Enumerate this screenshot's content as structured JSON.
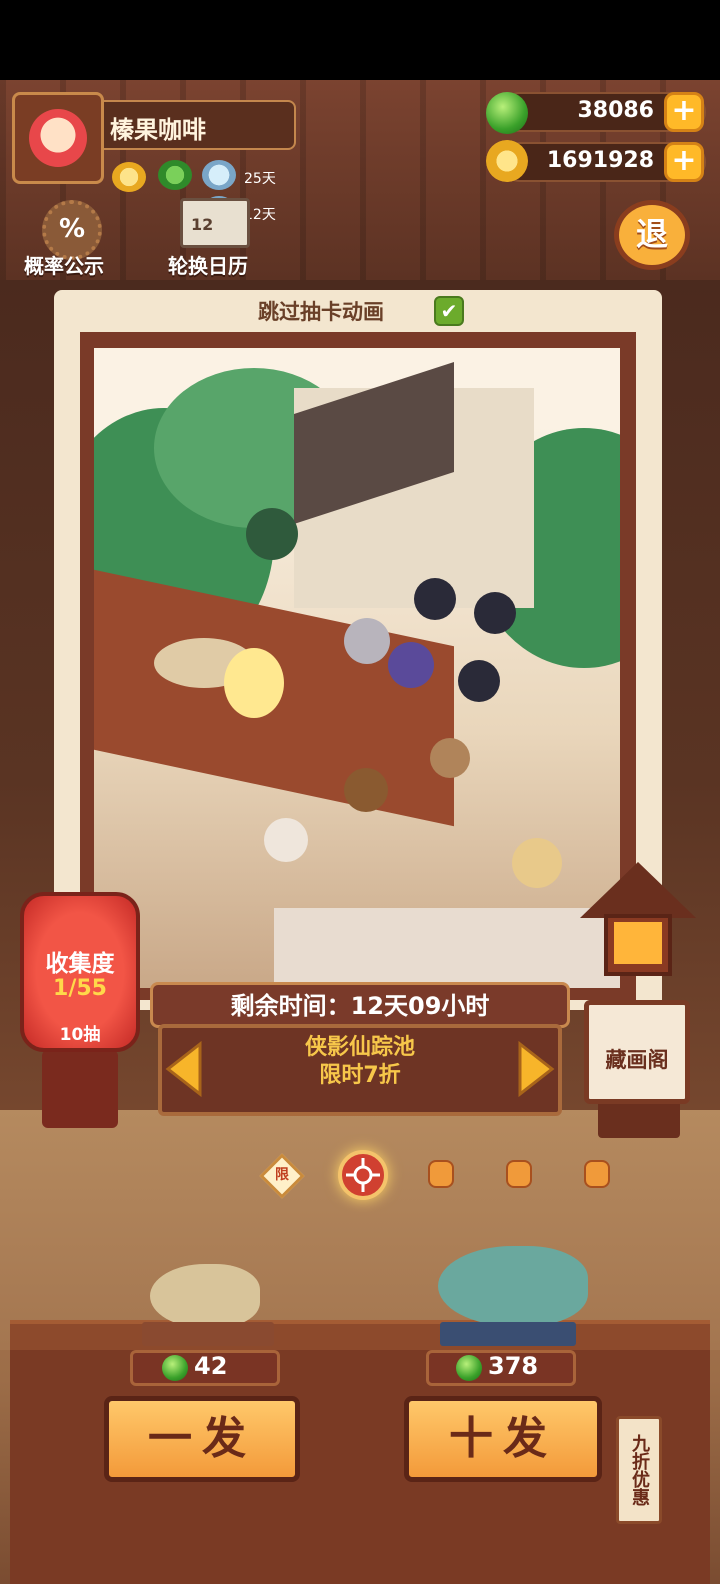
{
  "profile": {
    "name": "榛果咖啡",
    "buff_days_1": "25天",
    "buff_days_2": "12天"
  },
  "currency": {
    "gems": "38086",
    "coins": "1691928",
    "plus_label": "+"
  },
  "side_buttons": {
    "probability_icon": "%",
    "probability_label": "概率公示",
    "rotation_label": "轮换日历",
    "calendar_number": "12",
    "exit_label": "退"
  },
  "card": {
    "skip_animation_label": "跳过抽卡动画",
    "skip_checked": true,
    "check_mark": "✔"
  },
  "banner": {
    "timer": "剩余时间：12天09小时",
    "pool_name_line1": "侠影仙踪池",
    "pool_name_line2": "限时7折"
  },
  "collection": {
    "title": "收集度",
    "value": "1/55",
    "draws": "10抽"
  },
  "gallery": {
    "label": "藏画阁"
  },
  "pager": {
    "limited_label": "限",
    "active_index": 1,
    "count": 5
  },
  "draw": {
    "single_price": "42",
    "single_label": "一发",
    "ten_price": "378",
    "ten_label": "十发",
    "discount_tag": "九折优惠"
  },
  "colors": {
    "accent_orange": "#f39a3a",
    "wood_dark": "#7a3a24",
    "gem_green": "#3aa12a"
  }
}
